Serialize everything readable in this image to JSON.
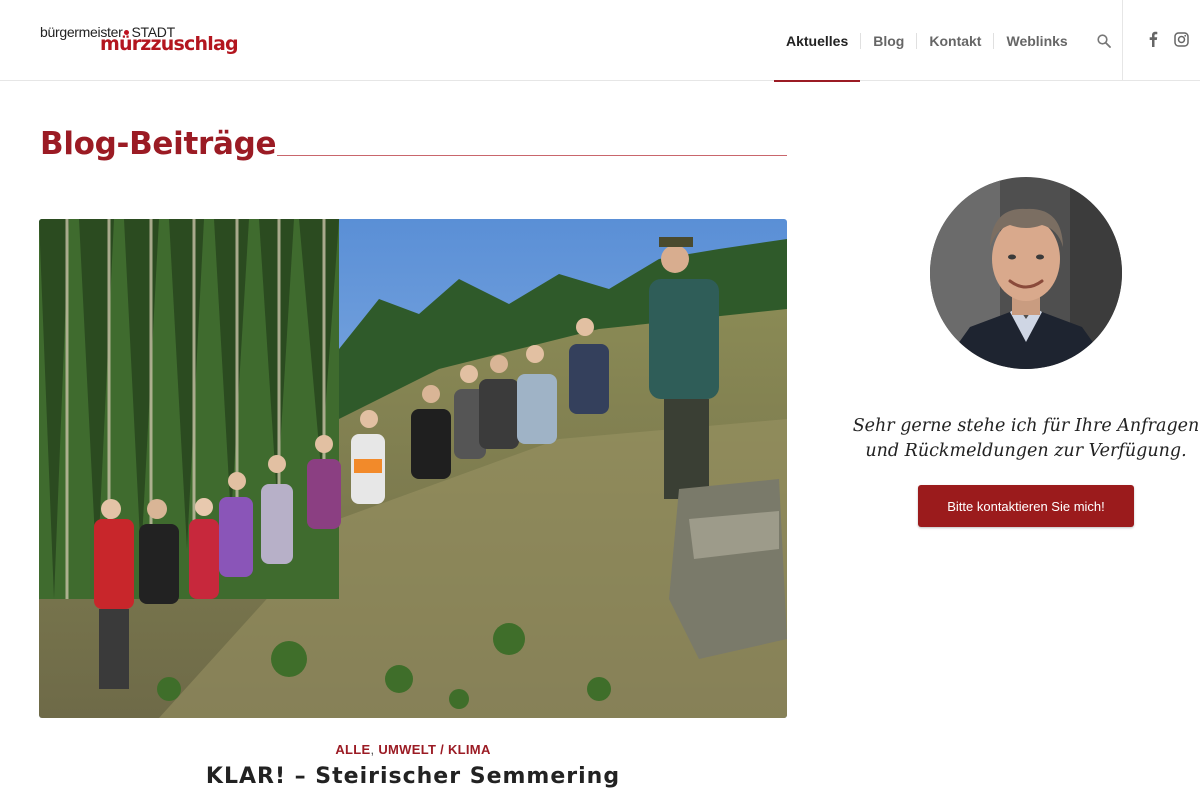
{
  "header": {
    "logo": {
      "top_text_1": "bürgermeister",
      "top_text_2": "STADT",
      "bottom_text": "mürzzuschlag"
    },
    "nav": [
      {
        "label": "Aktuelles",
        "active": true
      },
      {
        "label": "Blog",
        "active": false
      },
      {
        "label": "Kontakt",
        "active": false
      },
      {
        "label": "Weblinks",
        "active": false
      }
    ],
    "icons": [
      "search-icon",
      "facebook-icon",
      "instagram-icon"
    ]
  },
  "main": {
    "page_title": "Blog-Beiträge",
    "post": {
      "categories": [
        "ALLE",
        "UMWELT / KLIMA"
      ],
      "category_separator": ",",
      "title": "KLAR! – Steirischer Semmering"
    }
  },
  "sidebar": {
    "text_line1": "Sehr gerne stehe ich für Ihre Anfragen",
    "text_line2": "und Rückmeldungen zur Verfügung.",
    "button_label": "Bitte kontaktieren Sie mich!"
  },
  "colors": {
    "accent": "#9b1b24",
    "button": "#9b1b1c",
    "nav_text": "#666666"
  }
}
